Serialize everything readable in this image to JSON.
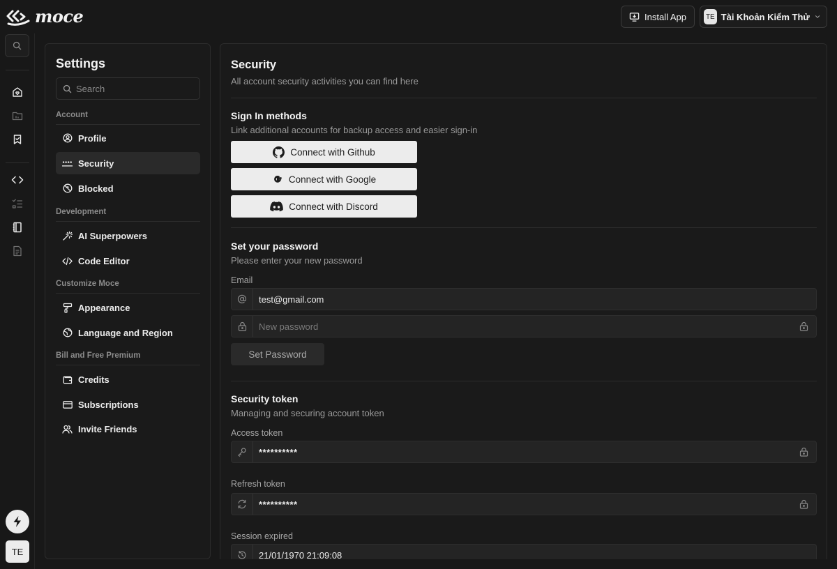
{
  "app": {
    "brand": "moce"
  },
  "topbar": {
    "install_label": "Install App",
    "account_initials": "TE",
    "account_name": "Tài Khoản Kiểm Thử"
  },
  "rail": {
    "avatar_initials": "TE"
  },
  "settings": {
    "title": "Settings",
    "search_placeholder": "Search",
    "groups": [
      {
        "label": "Account",
        "items": [
          {
            "label": "Profile",
            "icon": "user-circle-icon"
          },
          {
            "label": "Security",
            "icon": "password-dots-icon",
            "active": true
          },
          {
            "label": "Blocked",
            "icon": "blocked-icon"
          }
        ]
      },
      {
        "label": "Development",
        "items": [
          {
            "label": "AI Superpowers",
            "icon": "magic-wand-icon"
          },
          {
            "label": "Code Editor",
            "icon": "code-icon"
          }
        ]
      },
      {
        "label": "Customize Moce",
        "items": [
          {
            "label": "Appearance",
            "icon": "paint-roller-icon"
          },
          {
            "label": "Language and Region",
            "icon": "globe-icon"
          }
        ]
      },
      {
        "label": "Bill and Free Premium",
        "items": [
          {
            "label": "Credits",
            "icon": "wallet-icon"
          },
          {
            "label": "Subscriptions",
            "icon": "credit-card-icon"
          },
          {
            "label": "Invite Friends",
            "icon": "users-icon"
          }
        ]
      }
    ]
  },
  "security": {
    "title": "Security",
    "subtitle": "All account security activities you can find here",
    "signin": {
      "title": "Sign In methods",
      "subtitle": "Link additional accounts for backup access and easier sign-in",
      "github_label": "Connect with Github",
      "google_label": "Connect with Google",
      "discord_label": "Connect with Discord"
    },
    "password": {
      "title": "Set your password",
      "subtitle": "Please enter your new password",
      "email_label": "Email",
      "email_value": "test@gmail.com",
      "new_password_placeholder": "New password",
      "submit_label": "Set Password"
    },
    "token": {
      "title": "Security token",
      "subtitle": "Managing and securing account token",
      "access_label": "Access token",
      "access_value": "**********",
      "refresh_label": "Refresh token",
      "refresh_value": "**********",
      "session_label": "Session expired",
      "session_value": "21/01/1970 21:09:08"
    }
  },
  "colors": {
    "background": "#181818",
    "panel": "#1a1a1a",
    "active_item": "#2a2a2a",
    "oauth_button": "#ececec"
  }
}
